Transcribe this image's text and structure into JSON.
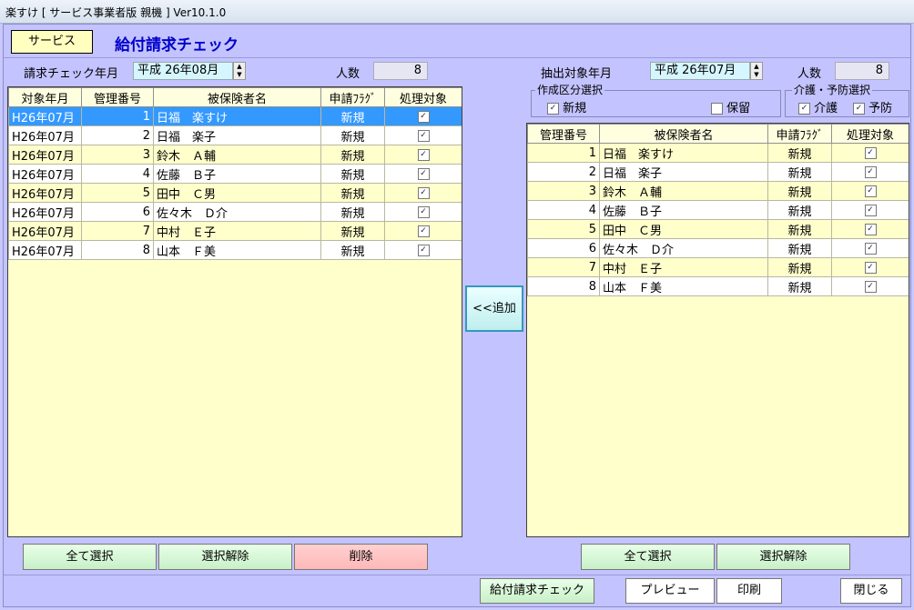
{
  "window": {
    "title": "楽すけ [ サービス事業者版 親機 ] Ver10.1.0"
  },
  "header": {
    "service_label": "サービス",
    "form_title": "給付請求チェック"
  },
  "left": {
    "month_label": "請求チェック年月",
    "month_value": "平成 26年08月",
    "count_label": "人数",
    "count_value": "8",
    "columns": [
      "対象年月",
      "管理番号",
      "被保険者名",
      "申請ﾌﾗｸﾞ",
      "処理対象"
    ],
    "rows": [
      {
        "ym": "H26年07月",
        "id": "1",
        "name": "日福　楽すけ",
        "flag": "新規"
      },
      {
        "ym": "H26年07月",
        "id": "2",
        "name": "日福　楽子",
        "flag": "新規"
      },
      {
        "ym": "H26年07月",
        "id": "3",
        "name": "鈴木　Ａ輔",
        "flag": "新規"
      },
      {
        "ym": "H26年07月",
        "id": "4",
        "name": "佐藤　Ｂ子",
        "flag": "新規"
      },
      {
        "ym": "H26年07月",
        "id": "5",
        "name": "田中　Ｃ男",
        "flag": "新規"
      },
      {
        "ym": "H26年07月",
        "id": "6",
        "name": "佐々木　Ｄ介",
        "flag": "新規"
      },
      {
        "ym": "H26年07月",
        "id": "7",
        "name": "中村　Ｅ子",
        "flag": "新規"
      },
      {
        "ym": "H26年07月",
        "id": "8",
        "name": "山本　Ｆ美",
        "flag": "新規"
      }
    ],
    "selected_row": 0,
    "buttons": {
      "select_all": "全て選択",
      "deselect": "選択解除",
      "delete": "削除"
    }
  },
  "center": {
    "add_button": "<<追加"
  },
  "right": {
    "month_label": "抽出対象年月",
    "month_value": "平成 26年07月",
    "count_label": "人数",
    "count_value": "8",
    "create_group": {
      "label": "作成区分選択",
      "new_label": "新規",
      "hold_label": "保留"
    },
    "care_group": {
      "label": "介護・予防選択",
      "care_label": "介護",
      "prevent_label": "予防"
    },
    "columns": [
      "管理番号",
      "被保険者名",
      "申請ﾌﾗｸﾞ",
      "処理対象"
    ],
    "rows": [
      {
        "id": "1",
        "name": "日福　楽すけ",
        "flag": "新規"
      },
      {
        "id": "2",
        "name": "日福　楽子",
        "flag": "新規"
      },
      {
        "id": "3",
        "name": "鈴木　Ａ輔",
        "flag": "新規"
      },
      {
        "id": "4",
        "name": "佐藤　Ｂ子",
        "flag": "新規"
      },
      {
        "id": "5",
        "name": "田中　Ｃ男",
        "flag": "新規"
      },
      {
        "id": "6",
        "name": "佐々木　Ｄ介",
        "flag": "新規"
      },
      {
        "id": "7",
        "name": "中村　Ｅ子",
        "flag": "新規"
      },
      {
        "id": "8",
        "name": "山本　Ｆ美",
        "flag": "新規"
      }
    ],
    "buttons": {
      "select_all": "全て選択",
      "deselect": "選択解除"
    }
  },
  "footer": {
    "check": "給付請求チェック",
    "preview": "プレビュー",
    "print": "印刷",
    "close": "閉じる"
  },
  "colors": {
    "background": "#c3c3ff",
    "title_blue": "#0000cc",
    "selection": "#3399ff",
    "grid_yellow": "#ffffcc"
  }
}
